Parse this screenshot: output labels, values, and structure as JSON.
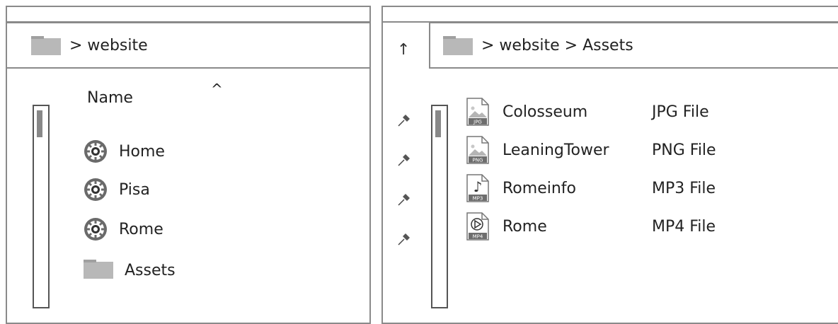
{
  "left_pane": {
    "breadcrumb": "> website",
    "column_header": "Name",
    "sort_indicator": "^",
    "items": [
      {
        "label": "Home",
        "icon": "webpage-icon"
      },
      {
        "label": "Pisa",
        "icon": "webpage-icon"
      },
      {
        "label": "Rome",
        "icon": "webpage-icon"
      },
      {
        "label": "Assets",
        "icon": "folder-icon"
      }
    ]
  },
  "right_pane": {
    "up_symbol": "↑",
    "breadcrumb": "> website > Assets",
    "files": [
      {
        "name": "Colosseum",
        "type": "JPG File",
        "badge": "JPG",
        "icon": "image-file-icon"
      },
      {
        "name": "LeaningTower",
        "type": "PNG File",
        "badge": "PNG",
        "icon": "image-file-icon"
      },
      {
        "name": "Romeinfo",
        "type": "MP3 File",
        "badge": "MP3",
        "icon": "audio-file-icon"
      },
      {
        "name": "Rome",
        "type": "MP4 File",
        "badge": "MP4",
        "icon": "video-file-icon"
      }
    ],
    "pin_icon": "pin-icon"
  },
  "colors": {
    "border": "#8a8a8a",
    "folder": "#b8b8b8",
    "text": "#222222"
  }
}
